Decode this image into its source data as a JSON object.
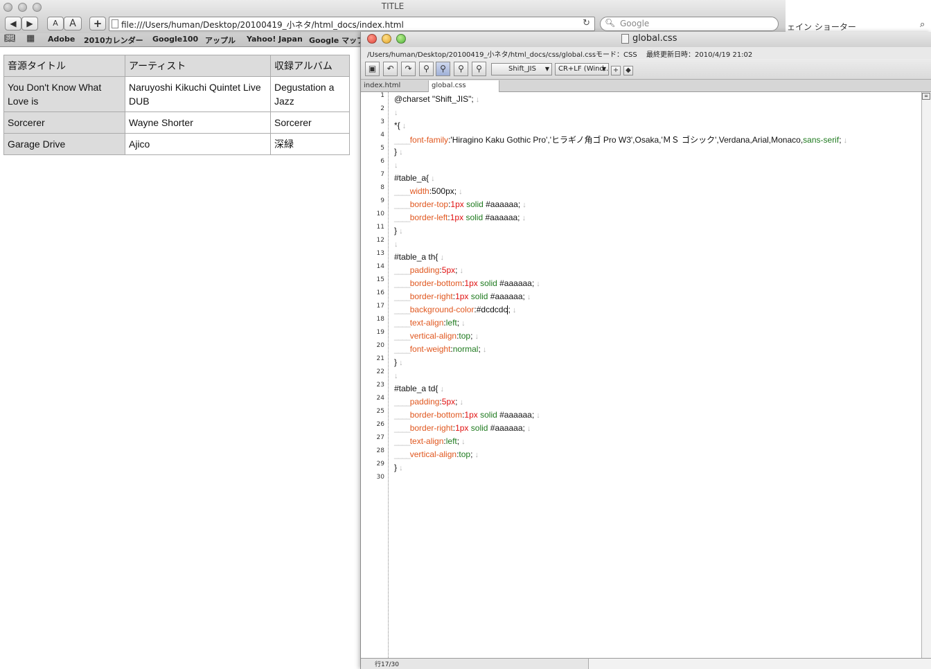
{
  "browser": {
    "title": "TITLE",
    "url": "file:///Users/human/Desktop/20100419_小ネタ/html_docs/index.html",
    "search_placeholder": "Google",
    "font_smaller": "A",
    "font_larger": "A",
    "add_label": "+",
    "bookmarks": [
      "Adobe",
      "2010カレンダー",
      "Google100",
      "アップル",
      "Yahoo! Japan",
      "Google マップ"
    ],
    "background_window_title": "ェイン ショーター"
  },
  "table": {
    "headers": [
      "音源タイトル",
      "アーティスト",
      "収録アルバム"
    ],
    "rows": [
      [
        "You Don't Know What Love is",
        "Naruyoshi Kikuchi Quintet Live DUB",
        "Degustation a Jazz"
      ],
      [
        "Sorcerer",
        "Wayne Shorter",
        "Sorcerer"
      ],
      [
        "Garage Drive",
        "Ajico",
        "深緑"
      ]
    ]
  },
  "editor": {
    "title": "global.css",
    "path": "/Users/human/Desktop/20100419_小ネタ/html_docs/css/global.css",
    "mode": "モード：CSS",
    "last_modified": "最終更新日時：2010/4/19 21:02",
    "encoding": "Shift_JIS",
    "line_ending": "CR+LF (Wind...",
    "tabs": [
      "index.html",
      "global.css"
    ],
    "status": "行17/30",
    "line_numbers": [
      "1",
      "2",
      "3",
      "4",
      "5",
      "6",
      "7",
      "8",
      "9",
      "10",
      "11",
      "12",
      "13",
      "14",
      "15",
      "16",
      "17",
      "18",
      "19",
      "20",
      "21",
      "22",
      "23",
      "24",
      "25",
      "26",
      "27",
      "28",
      "29",
      "30"
    ]
  },
  "code_lines": [
    [
      [
        "t",
        "@charset \"Shift_JIS\";"
      ],
      [
        "n",
        " ↓"
      ]
    ],
    [
      [
        "n",
        " ↓"
      ]
    ],
    [
      [
        "t",
        "*{"
      ],
      [
        "n",
        " ↓"
      ]
    ],
    [
      [
        "s",
        "____"
      ],
      [
        "p",
        "font-family"
      ],
      [
        "t",
        ":'Hiragino Kaku Gothic Pro','ヒラギノ角ゴ Pro W3',Osaka,'ＭＳ ゴシック',Verdana,Arial,Monaco,"
      ],
      [
        "k",
        "sans-serif"
      ],
      [
        "t",
        ";"
      ],
      [
        "n",
        " ↓"
      ]
    ],
    [
      [
        "t",
        "}"
      ],
      [
        "n",
        " ↓"
      ]
    ],
    [
      [
        "n",
        " ↓"
      ]
    ],
    [
      [
        "t",
        "#table_a{"
      ],
      [
        "n",
        " ↓"
      ]
    ],
    [
      [
        "s",
        "____"
      ],
      [
        "p",
        "width"
      ],
      [
        "t",
        ":500px;"
      ],
      [
        "n",
        " ↓"
      ]
    ],
    [
      [
        "s",
        "____"
      ],
      [
        "p",
        "border-top"
      ],
      [
        "t",
        ":"
      ],
      [
        "r",
        "1px"
      ],
      [
        "k",
        " solid"
      ],
      [
        "t",
        " #aaaaaa;"
      ],
      [
        "n",
        " ↓"
      ]
    ],
    [
      [
        "s",
        "____"
      ],
      [
        "p",
        "border-left"
      ],
      [
        "t",
        ":"
      ],
      [
        "r",
        "1px"
      ],
      [
        "k",
        " solid"
      ],
      [
        "t",
        " #aaaaaa;"
      ],
      [
        "n",
        " ↓"
      ]
    ],
    [
      [
        "t",
        "}"
      ],
      [
        "n",
        " ↓"
      ]
    ],
    [
      [
        "n",
        " ↓"
      ]
    ],
    [
      [
        "t",
        "#table_a th{"
      ],
      [
        "n",
        " ↓"
      ]
    ],
    [
      [
        "s",
        "____"
      ],
      [
        "p",
        "padding"
      ],
      [
        "t",
        ":"
      ],
      [
        "r",
        "5px"
      ],
      [
        "t",
        ";"
      ],
      [
        "n",
        " ↓"
      ]
    ],
    [
      [
        "s",
        "____"
      ],
      [
        "p",
        "border-bottom"
      ],
      [
        "t",
        ":"
      ],
      [
        "r",
        "1px"
      ],
      [
        "k",
        " solid"
      ],
      [
        "t",
        " #aaaaaa;"
      ],
      [
        "n",
        " ↓"
      ]
    ],
    [
      [
        "s",
        "____"
      ],
      [
        "p",
        "border-right"
      ],
      [
        "t",
        ":"
      ],
      [
        "r",
        "1px"
      ],
      [
        "k",
        " solid"
      ],
      [
        "t",
        " #aaaaaa;"
      ],
      [
        "n",
        " ↓"
      ]
    ],
    [
      [
        "s",
        "____"
      ],
      [
        "p",
        "background-color"
      ],
      [
        "t",
        ":#dcdcdc"
      ],
      [
        "c",
        ""
      ],
      [
        "t",
        ";"
      ],
      [
        "n",
        " ↓"
      ]
    ],
    [
      [
        "s",
        "____"
      ],
      [
        "p",
        "text-align"
      ],
      [
        "t",
        ":"
      ],
      [
        "k",
        "left"
      ],
      [
        "t",
        ";"
      ],
      [
        "n",
        " ↓"
      ]
    ],
    [
      [
        "s",
        "____"
      ],
      [
        "p",
        "vertical-align"
      ],
      [
        "t",
        ":"
      ],
      [
        "k",
        "top"
      ],
      [
        "t",
        ";"
      ],
      [
        "n",
        " ↓"
      ]
    ],
    [
      [
        "s",
        "____"
      ],
      [
        "p",
        "font-weight"
      ],
      [
        "t",
        ":"
      ],
      [
        "k",
        "normal"
      ],
      [
        "t",
        ";"
      ],
      [
        "n",
        " ↓"
      ]
    ],
    [
      [
        "t",
        "}"
      ],
      [
        "n",
        " ↓"
      ]
    ],
    [
      [
        "n",
        " ↓"
      ]
    ],
    [
      [
        "t",
        "#table_a td{"
      ],
      [
        "n",
        " ↓"
      ]
    ],
    [
      [
        "s",
        "____"
      ],
      [
        "p",
        "padding"
      ],
      [
        "t",
        ":"
      ],
      [
        "r",
        "5px"
      ],
      [
        "t",
        ";"
      ],
      [
        "n",
        " ↓"
      ]
    ],
    [
      [
        "s",
        "____"
      ],
      [
        "p",
        "border-bottom"
      ],
      [
        "t",
        ":"
      ],
      [
        "r",
        "1px"
      ],
      [
        "k",
        " solid"
      ],
      [
        "t",
        " #aaaaaa;"
      ],
      [
        "n",
        " ↓"
      ]
    ],
    [
      [
        "s",
        "____"
      ],
      [
        "p",
        "border-right"
      ],
      [
        "t",
        ":"
      ],
      [
        "r",
        "1px"
      ],
      [
        "k",
        " solid"
      ],
      [
        "t",
        " #aaaaaa;"
      ],
      [
        "n",
        " ↓"
      ]
    ],
    [
      [
        "s",
        "____"
      ],
      [
        "p",
        "text-align"
      ],
      [
        "t",
        ":"
      ],
      [
        "k",
        "left"
      ],
      [
        "t",
        ";"
      ],
      [
        "n",
        " ↓"
      ]
    ],
    [
      [
        "s",
        "____"
      ],
      [
        "p",
        "vertical-align"
      ],
      [
        "t",
        ":"
      ],
      [
        "k",
        "top"
      ],
      [
        "t",
        ";"
      ],
      [
        "n",
        " ↓"
      ]
    ],
    [
      [
        "t",
        "}"
      ],
      [
        "n",
        " ↓"
      ]
    ],
    []
  ]
}
